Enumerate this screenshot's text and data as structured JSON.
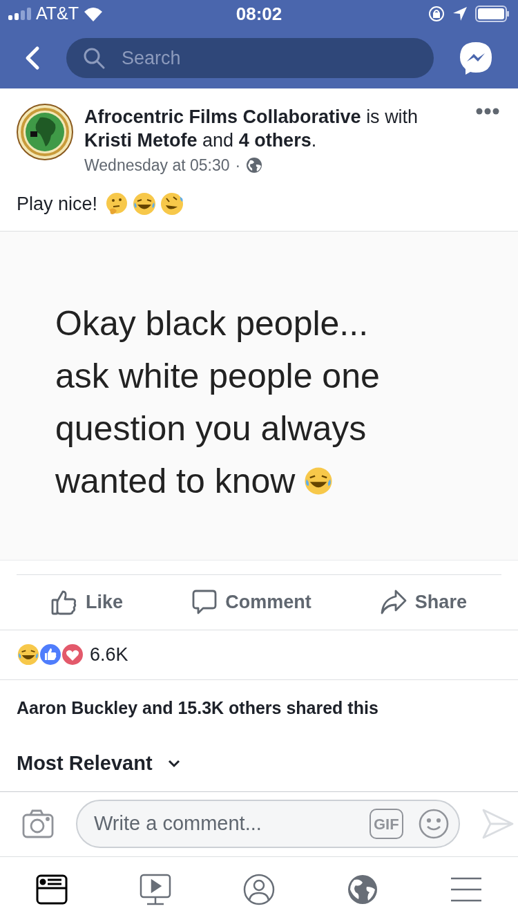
{
  "status_bar": {
    "carrier": "AT&T",
    "time": "08:02"
  },
  "nav": {
    "search": {
      "placeholder": "Search"
    }
  },
  "post": {
    "author": "Afrocentric Films Collaborative",
    "with_text": "is with",
    "tagged": "Kristi Metofe",
    "and_text": "and",
    "others": "4 others",
    "period": ".",
    "time": "Wednesday at 05:30",
    "separator": "·",
    "caption": "Play nice!",
    "image_lines": [
      "Okay black people...",
      "ask white people one",
      "question you always",
      "wanted to know"
    ]
  },
  "actions": [
    {
      "kind": "like",
      "label": "Like"
    },
    {
      "kind": "comment",
      "label": "Comment"
    },
    {
      "kind": "share",
      "label": "Share"
    }
  ],
  "reactions": {
    "count": "6.6K"
  },
  "shares": "Aaron Buckley and 15.3K others shared this",
  "sort": "Most Relevant",
  "comment_bar": {
    "placeholder": "Write a comment...",
    "gif": "GIF"
  },
  "tabs": [
    {
      "kind": "feed",
      "selected": true
    },
    {
      "kind": "video",
      "selected": false
    },
    {
      "kind": "profile",
      "selected": false
    },
    {
      "kind": "globe",
      "selected": false
    },
    {
      "kind": "menu",
      "selected": false
    }
  ]
}
